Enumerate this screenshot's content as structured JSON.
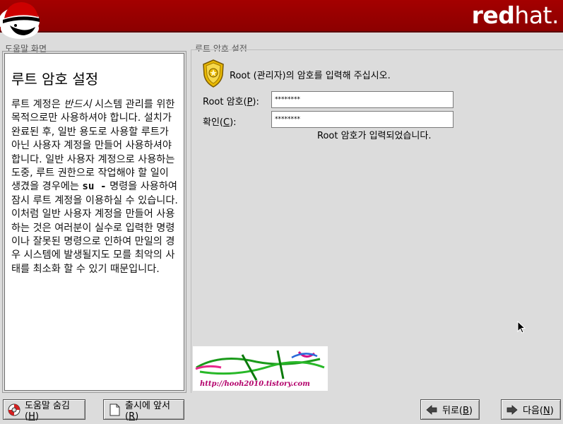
{
  "header": {
    "brand_bold": "red",
    "brand_light": "hat."
  },
  "help": {
    "frame_label": "도움말 화면",
    "title": "루트 암호 설정",
    "body_before_em": "루트 계정은 ",
    "body_em": "반드시",
    "body_after_em": " 시스템 관리를 위한 목적으로만 사용하셔야 합니다. 설치가 완료된 후, 일반 용도로 사용할 루트가 아닌 사용자 계정을 만들어 사용하셔야 합니다. 일반 사용자 계정으로 사용하는 도중, 루트 권한으로 작업해야 할 일이 생겼을 경우에는 ",
    "body_cmd": "su -",
    "body_end": " 명령을 사용하여 잠시 루트 계정을 이용하실 수 있습니다. 이처럼 일반 사용자 계정을 만들어 사용하는 것은 여러분이 실수로 입력한 명령이나 잘못된 명령으로 인하여 만일의 경우 시스템에 발생될지도 모를 최악의 사태를 최소화 할 수 있기 때문입니다."
  },
  "main": {
    "frame_label": "루트 암호 설정",
    "intro_root": "Root",
    "intro_rest": " (관리자)의 암호를 입력해 주십시오.",
    "password": {
      "label_pre": "Root 암호(",
      "label_key": "P",
      "label_post": "):",
      "value": "********"
    },
    "confirm": {
      "label_pre": "확인(",
      "label_key": "C",
      "label_post": "):",
      "value": "********"
    },
    "status": "Root 암호가 입력되었습니다.",
    "watermark_url": "http://hooh2010.tistory.com"
  },
  "buttons": {
    "hide_help": {
      "pre": "도움말 숨김(",
      "key": "H",
      "post": ")"
    },
    "release_notes": {
      "pre": "출시에 앞서(",
      "key": "R",
      "post": ")"
    },
    "back": {
      "pre": "뒤로(",
      "key": "B",
      "post": ")"
    },
    "next": {
      "pre": "다음(",
      "key": "N",
      "post": ")"
    }
  },
  "colors": {
    "banner": "#a40000",
    "background": "#dcdcdc",
    "watermark": "#b3006b"
  }
}
